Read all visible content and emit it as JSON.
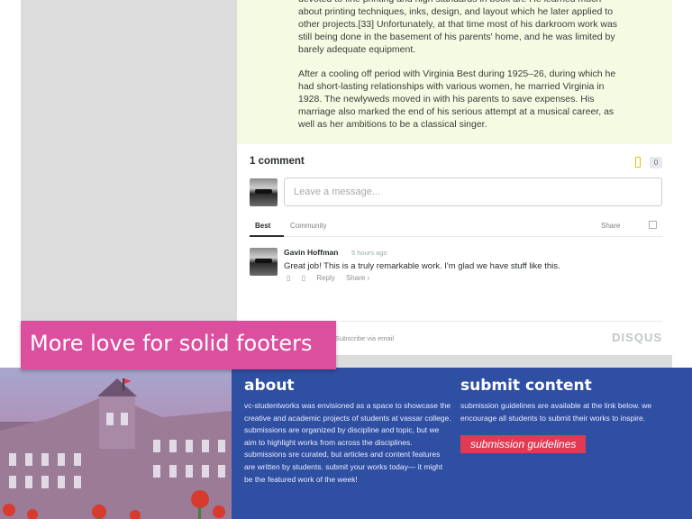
{
  "article": {
    "paragraphs": [
      "devoted to fine printing and high standards in book art. He learned much about printing techniques, inks, design, and layout which he later applied to other projects.[33] Unfortunately, at that time most of his darkroom work was still being done in the basement of his parents' home, and he was limited by barely adequate equipment.",
      "After a cooling off period with Virginia Best during 1925–26, during which he had short-lasting relationships with various women, he married Virginia in 1928. The newlyweds moved in with his parents to save expenses. His marriage also marked the end of his serious attempt at a musical career, as well as her ambitions to be a classical singer."
    ]
  },
  "comments": {
    "count_label": "1 comment",
    "fav_count": "0",
    "input_placeholder": "Leave a message...",
    "tabs": {
      "best": "Best",
      "community": "Community",
      "share": "Share"
    },
    "items": [
      {
        "author": "Gavin Hoffman",
        "time": "5 hours ago",
        "body": "Great job! This is a truly remarkable work. I'm glad we have stuff like this.",
        "reply": "Reply",
        "share": "Share ›"
      }
    ],
    "subscribe": "Subscribe via email",
    "disqus": "DISQUS"
  },
  "banner": {
    "text": "More love for solid footers",
    "color": "#dc4f9f"
  },
  "footer": {
    "about_title": "about",
    "about_text": "vc-studentworks was envisioned as a space to showcase the creative and academic projects of students at vassar college. submissions are organized by discipline and topic, but we aim to highlight works from across the disciplines. submissions sre curated, but articles and content features are written by students. submit your works today— it might be the featured work of the week!",
    "submit_title": "submit content",
    "submit_text": "submission guidelines are available at the link below. we encourage all students to submit their works to inspire.",
    "button_label": "submission guidelines",
    "colors": {
      "background": "#2f4fa2",
      "button": "#e23a53"
    }
  }
}
